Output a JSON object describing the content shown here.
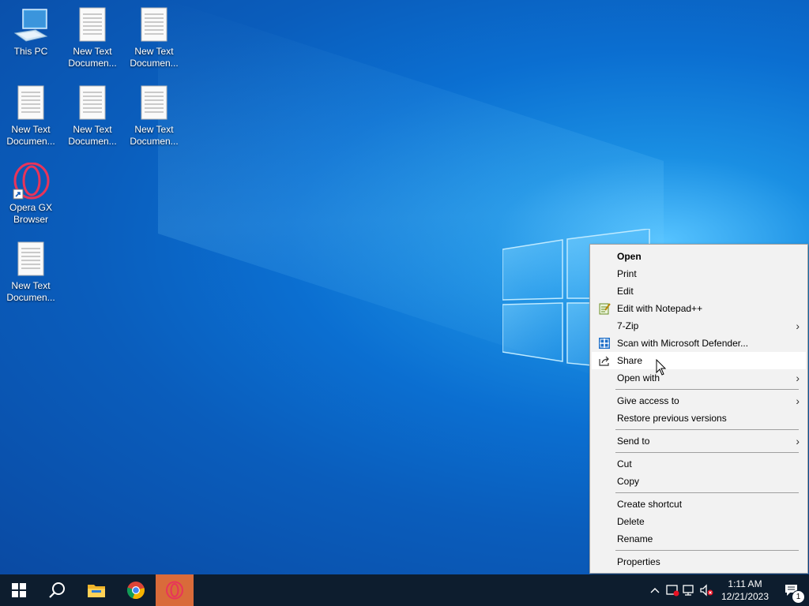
{
  "desktop": {
    "icons": [
      {
        "label": "This PC"
      },
      {
        "label": "New Text Documen..."
      },
      {
        "label": "New Text Documen..."
      },
      {
        "label": "New Text Documen..."
      },
      {
        "label": "New Text Documen..."
      },
      {
        "label": "New Text Documen..."
      },
      {
        "label": "Opera GX Browser"
      },
      {
        "label": "New Text Documen..."
      }
    ]
  },
  "context_menu": {
    "items": [
      {
        "label": "Open"
      },
      {
        "label": "Print"
      },
      {
        "label": "Edit"
      },
      {
        "label": "Edit with Notepad++"
      },
      {
        "label": "7-Zip"
      },
      {
        "label": "Scan with Microsoft Defender..."
      },
      {
        "label": "Share"
      },
      {
        "label": "Open with"
      },
      {
        "label": "Give access to"
      },
      {
        "label": "Restore previous versions"
      },
      {
        "label": "Send to"
      },
      {
        "label": "Cut"
      },
      {
        "label": "Copy"
      },
      {
        "label": "Create shortcut"
      },
      {
        "label": "Delete"
      },
      {
        "label": "Rename"
      },
      {
        "label": "Properties"
      }
    ],
    "submenu_arrow": "›"
  },
  "taskbar": {
    "clock_time": "1:11 AM",
    "clock_date": "12/21/2023",
    "notification_count": "1"
  },
  "colors": {
    "accent_opera": "#d96b3a",
    "taskbar_bg": "#0d1d2e",
    "menu_bg": "#f2f2f2"
  }
}
